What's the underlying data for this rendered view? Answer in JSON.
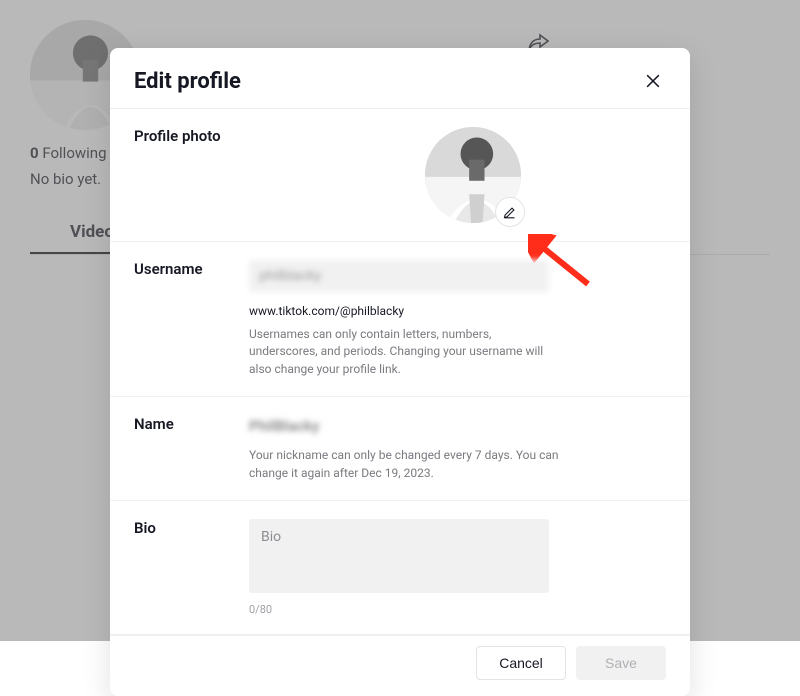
{
  "background": {
    "following_count": "0",
    "following_label": "Following",
    "bio_text": "No bio yet.",
    "tab_videos": "Videos"
  },
  "modal": {
    "title": "Edit profile",
    "sections": {
      "photo_label": "Profile photo",
      "username_label": "Username",
      "username_value": "philblacky",
      "username_url": "www.tiktok.com/@philblacky",
      "username_help": "Usernames can only contain letters, numbers, underscores, and periods. Changing your username will also change your profile link.",
      "name_label": "Name",
      "name_value": "PhilBlacky",
      "name_help": "Your nickname can only be changed every 7 days. You can change it again after Dec 19, 2023.",
      "bio_label": "Bio",
      "bio_placeholder": "Bio",
      "bio_count": "0/80"
    },
    "footer": {
      "cancel_label": "Cancel",
      "save_label": "Save"
    }
  }
}
